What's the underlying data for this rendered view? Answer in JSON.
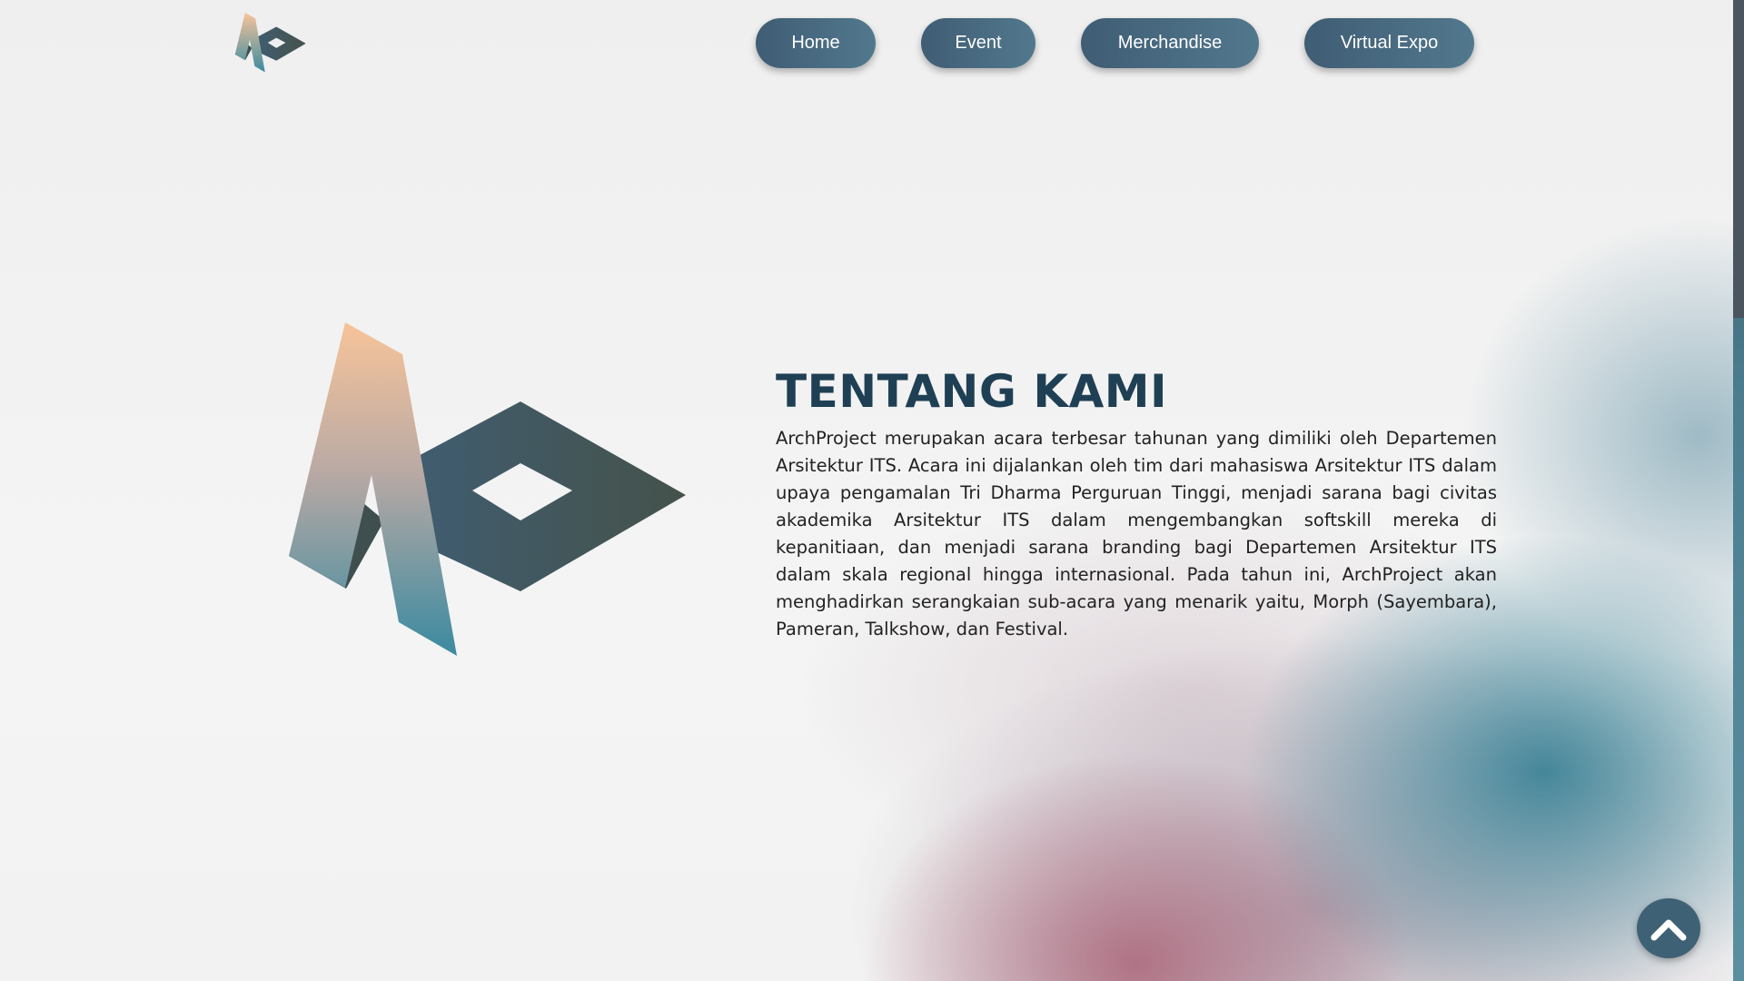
{
  "nav": {
    "items": [
      {
        "label": "Home"
      },
      {
        "label": "Event"
      },
      {
        "label": "Merchandise"
      },
      {
        "label": "Virtual Expo"
      }
    ]
  },
  "about": {
    "title": "TENTANG KAMI",
    "text": "ArchProject merupakan acara terbesar tahunan yang dimiliki oleh Departemen Arsitektur ITS. Acara ini dijalankan oleh tim dari mahasiswa Arsitektur ITS dalam upaya pengamalan Tri Dharma Perguruan Tinggi, menjadi sarana bagi civitas akademika Arsitektur ITS dalam mengembangkan softskill mereka di kepanitiaan, dan menjadi sarana branding bagi Departemen Arsitektur ITS dalam skala regional hingga internasional. Pada tahun ini, ArchProject akan menghadirkan serangkaian sub-acara yang menarik yaitu, Morph (Sayembara), Pameran, Talkshow, dan Festival."
  },
  "icons": {
    "logo": "archproject-logo-icon",
    "back_to_top": "chevron-up-icon"
  },
  "colors": {
    "nav_button": "#3f5d74",
    "title": "#1f4054",
    "logo_peach": "#f7c49a",
    "logo_teal": "#3a8aa0",
    "logo_dark": "#3f5562"
  }
}
